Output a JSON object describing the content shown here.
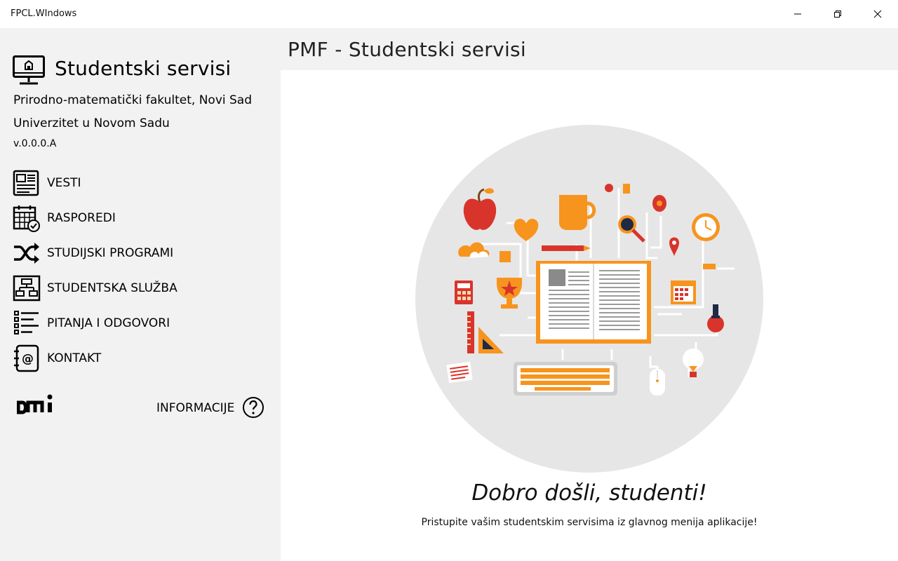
{
  "window": {
    "title": "FPCL.WIndows"
  },
  "sidebar": {
    "brand_title": "Studentski servisi",
    "subtitle_faculty": "Prirodno-matematički fakultet, Novi Sad",
    "subtitle_university": "Univerzitet u Novom Sadu",
    "version": "v.0.0.0.A",
    "items": [
      {
        "label": "VESTI",
        "icon": "newspaper-icon"
      },
      {
        "label": "RASPOREDI",
        "icon": "calendar-check-icon"
      },
      {
        "label": "STUDIJSKI PROGRAMI",
        "icon": "shuffle-icon"
      },
      {
        "label": "STUDENTSKA SLUŽBA",
        "icon": "network-icon"
      },
      {
        "label": "PITANJA I ODGOVORI",
        "icon": "list-icon"
      },
      {
        "label": "KONTAKT",
        "icon": "contact-book-icon"
      }
    ],
    "info_label": "INFORMACIJE",
    "logo": "dmi-logo"
  },
  "main": {
    "page_title": "PMF - Studentski servisi",
    "welcome_title": "Dobro došli, studenti!",
    "welcome_subtitle": "Pristupite vašim studentskim servisima iz glavnog menija aplikacije!"
  },
  "colors": {
    "sidebar_bg": "#f2f2f2",
    "hero_circle": "#e6e6e6",
    "accent_orange": "#f7941d",
    "accent_red": "#d9342b"
  }
}
